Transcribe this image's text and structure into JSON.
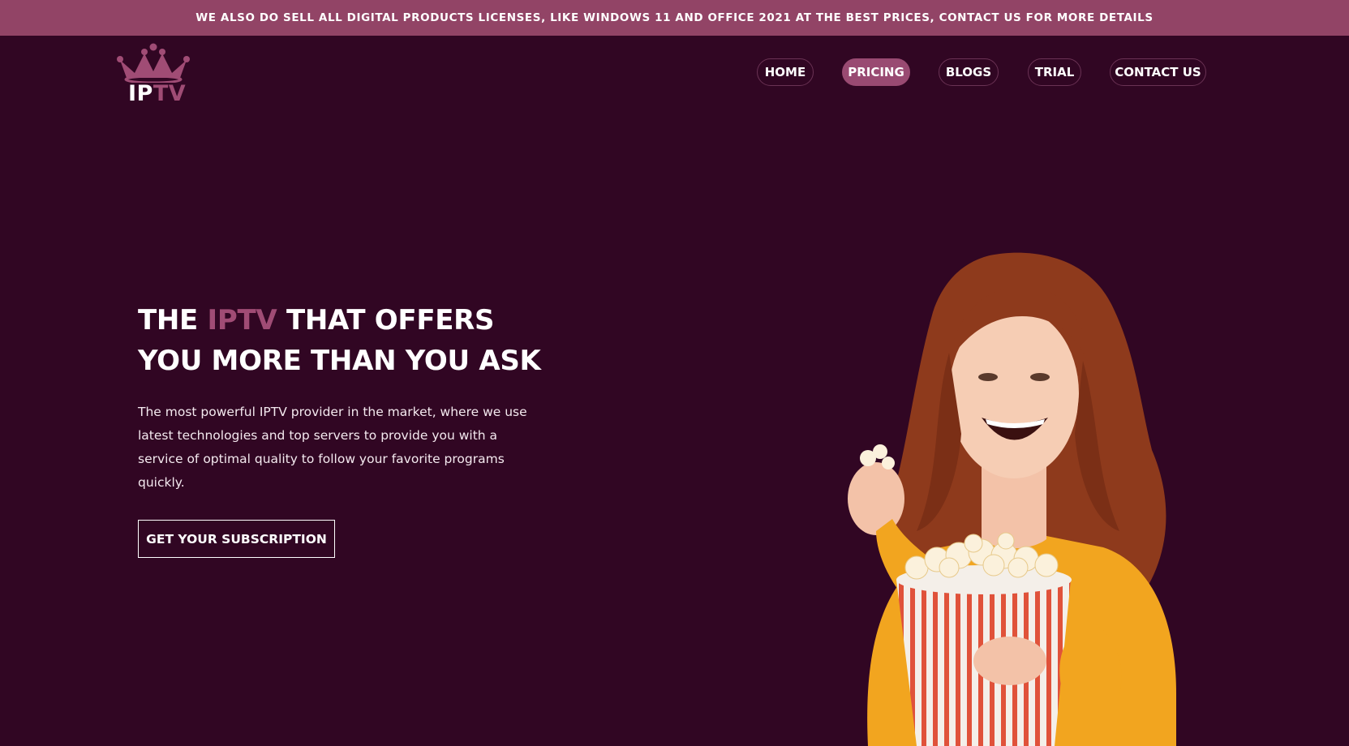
{
  "announcement": "WE ALSO DO SELL ALL DIGITAL PRODUCTS LICENSES, LIKE WINDOWS 11 AND OFFICE 2021 AT THE BEST PRICES, CONTACT US FOR MORE DETAILS",
  "logo": {
    "text_part1": "IP",
    "text_part2": "TV",
    "icon": "crown-icon"
  },
  "nav": {
    "items": [
      {
        "label": "HOME"
      },
      {
        "label": "PRICING",
        "active": true
      },
      {
        "label": "BLOGS"
      },
      {
        "label": "TRIAL"
      },
      {
        "label": "CONTACT US"
      }
    ]
  },
  "hero": {
    "title_part1": "THE ",
    "title_accent": "IPTV",
    "title_part2": " THAT OFFERS YOU MORE THAN YOU ASK",
    "description": "The most powerful IPTV provider in the market, where we use latest technologies and top servers to provide you with a service of optimal quality to follow your favorite programs quickly.",
    "cta_label": "GET YOUR SUBSCRIPTION"
  },
  "colors": {
    "background": "#310623",
    "announcement_bar": "#924466",
    "accent": "#a04c75",
    "sweater": "#f2a51f",
    "hair": "#8e3a1c"
  }
}
